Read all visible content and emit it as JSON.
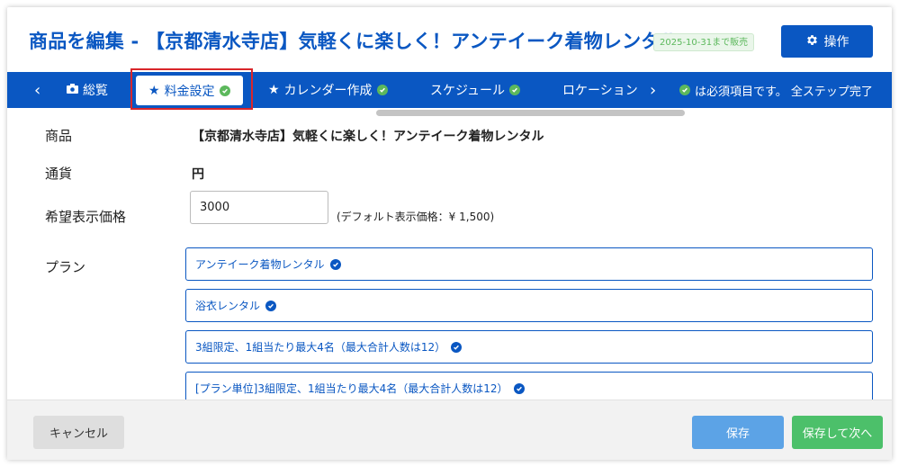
{
  "header": {
    "title": "商品を編集 - 【京都清水寺店】気軽くに楽しく！アンテイーク着物レンタル",
    "sale_badge": "2025-10-31まで販売",
    "ops_button": "操作"
  },
  "steps": {
    "prev_arrow": "‹",
    "overview": "総覧",
    "pricing": "料金設定",
    "calendar": "カレンダー作成",
    "schedule": "スケジュール",
    "location": "ロケーション",
    "next_arrow": "›",
    "required_note": "は必須項目です。 全ステップ完了"
  },
  "form": {
    "product_label": "商品",
    "product_value": "【京都清水寺店】気軽くに楽しく！アンテイーク着物レンタル",
    "currency_label": "通貨",
    "currency_value": "円",
    "price_label": "希望表示価格",
    "price_value": "3000",
    "price_hint": "(デフォルト表示価格：¥ 1,500)",
    "plan_label": "プラン",
    "plans": [
      "アンテイーク着物レンタル",
      "浴衣レンタル",
      "3組限定、1組当たり最大4名（最大合計人数は12）",
      "[プラン単位]3組限定、1組当たり最大4名（最大合計人数は12）"
    ]
  },
  "footer": {
    "cancel": "キャンセル",
    "save": "保存",
    "save_next": "保存して次へ"
  },
  "colors": {
    "brand_blue": "#0a57c2",
    "check_green": "#5cb85c",
    "highlight_red": "#d9262b"
  }
}
